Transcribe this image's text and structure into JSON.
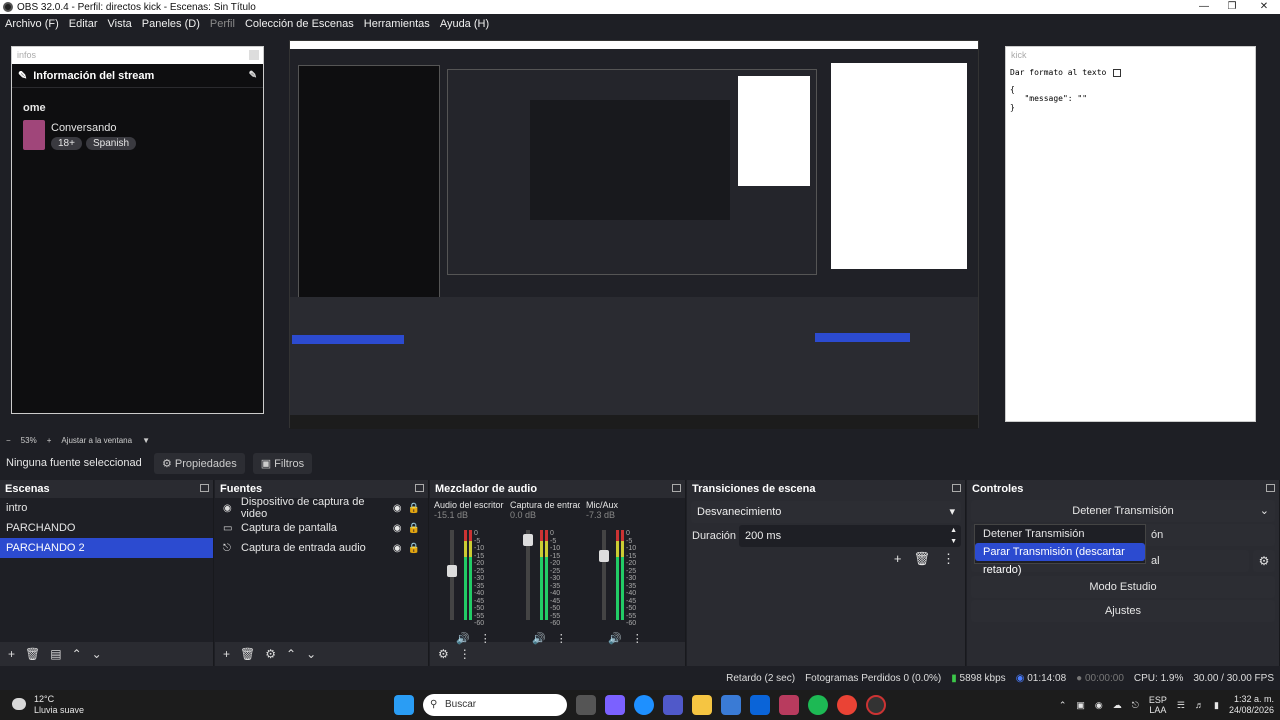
{
  "window": {
    "title": "OBS 32.0.4 - Perfil: directos kick - Escenas: Sin Título"
  },
  "menu": [
    "Archivo (F)",
    "Editar",
    "Vista",
    "Paneles (D)",
    "Perfil",
    "Colección de Escenas",
    "Herramientas",
    "Ayuda (H)"
  ],
  "infos_dock": {
    "title": "infos",
    "header": "Información del stream",
    "user": "ome",
    "category": "Conversando",
    "tags": [
      "18+",
      "Spanish"
    ]
  },
  "kick_dock": {
    "title": "kick",
    "format_label": "Dar formato al texto",
    "json_text": "{\n   \"message\": \"\"\n}"
  },
  "zoom": {
    "value": "53%",
    "fit_label": "Ajustar a la ventana"
  },
  "source_bar": {
    "no_source": "Ninguna fuente seleccionad",
    "properties": "Propiedades",
    "filters": "Filtros"
  },
  "scenes": {
    "title": "Escenas",
    "items": [
      "intro",
      "PARCHANDO",
      "PARCHANDO 2"
    ],
    "selected": 2
  },
  "sources": {
    "title": "Fuentes",
    "items": [
      "Dispositivo de captura de video",
      "Captura de pantalla",
      "Captura de entrada audio"
    ]
  },
  "mixer": {
    "title": "Mezclador de audio",
    "channels": [
      {
        "name": "Audio del escritorio",
        "db": "-15.1 dB",
        "fader": 0.55
      },
      {
        "name": "Captura de entrada",
        "db": "0.0 dB",
        "fader": 0.95
      },
      {
        "name": "Mic/Aux",
        "db": "-7.3 dB",
        "fader": 0.75
      }
    ],
    "scale": [
      "0",
      "-5",
      "-10",
      "-15",
      "-20",
      "-25",
      "-30",
      "-35",
      "-40",
      "-45",
      "-50",
      "-55",
      "-60"
    ]
  },
  "transitions": {
    "title": "Transiciones de escena",
    "selected": "Desvanecimiento",
    "duration_label": "Duración",
    "duration_value": "200 ms"
  },
  "controls": {
    "title": "Controles",
    "stop_stream": "Detener Transmisión",
    "popup": [
      "Detener Transmisión",
      "Parar Transmisión (descartar retardo)"
    ],
    "partial_1": "ón",
    "partial_2": "al",
    "studio": "Modo Estudio",
    "settings": "Ajustes"
  },
  "status": {
    "delay": "Retardo (2 sec)",
    "dropped": "Fotogramas Perdidos 0 (0.0%)",
    "bitrate": "5898 kbps",
    "live_time": "01:14:08",
    "rec_time": "00:00:00",
    "cpu": "CPU: 1.9%",
    "fps": "30.00 / 30.00 FPS"
  },
  "taskbar": {
    "temp": "12°C",
    "weather": "Lluvia suave",
    "search": "Buscar",
    "lang1": "ESP",
    "lang2": "LAA",
    "time": "1:32 a. m.",
    "date": "24/08/2026"
  }
}
